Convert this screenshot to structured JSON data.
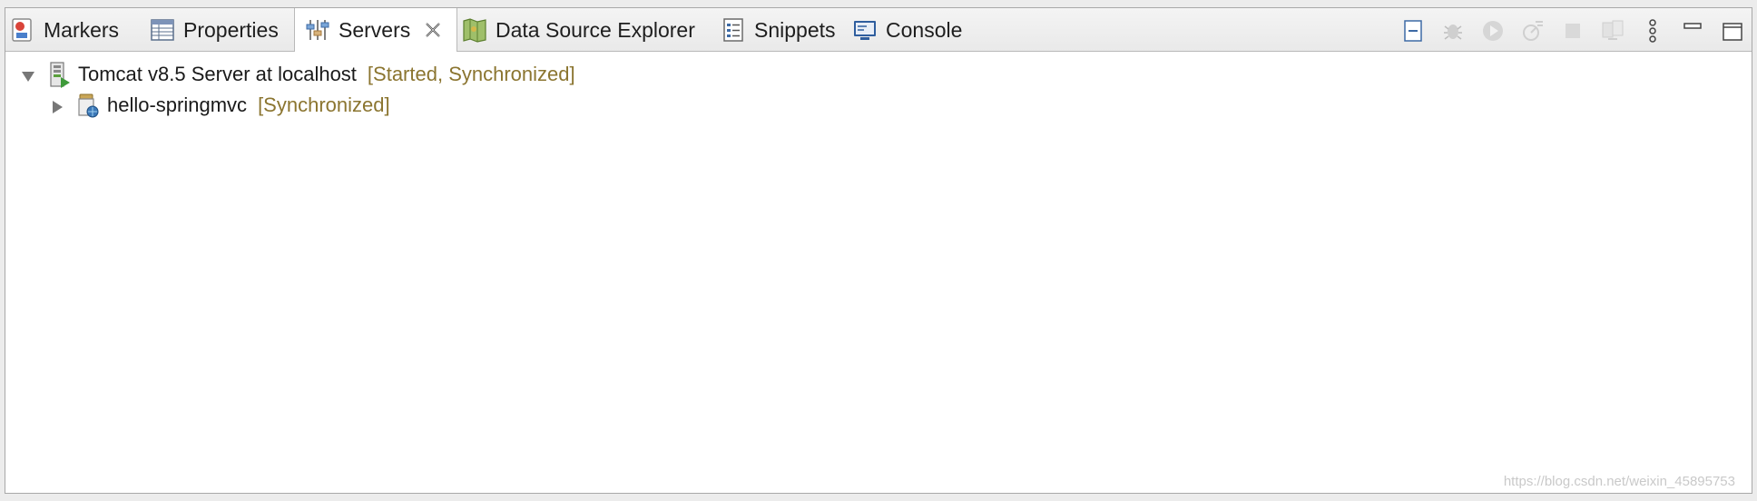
{
  "tabs": [
    {
      "label": "Markers",
      "icon": "markers-icon"
    },
    {
      "label": "Properties",
      "icon": "properties-icon"
    },
    {
      "label": "Servers",
      "icon": "servers-icon",
      "active": true
    },
    {
      "label": "Data Source Explorer",
      "icon": "datasource-icon"
    },
    {
      "label": "Snippets",
      "icon": "snippets-icon"
    },
    {
      "label": "Console",
      "icon": "console-icon"
    }
  ],
  "toolbar": [
    "collapse-all-icon",
    "debug-server-icon",
    "start-server-icon",
    "profile-server-icon",
    "stop-server-icon",
    "publish-icon",
    "view-menu-icon",
    "minimize-icon",
    "maximize-icon"
  ],
  "tree": {
    "server": {
      "name": "Tomcat v8.5 Server at localhost",
      "status": "[Started, Synchronized]"
    },
    "module": {
      "name": "hello-springmvc",
      "status": "[Synchronized]"
    }
  },
  "watermark": "https://blog.csdn.net/weixin_45895753",
  "colors": {
    "status": "#8b7530",
    "tab_bar": "#ececec"
  }
}
